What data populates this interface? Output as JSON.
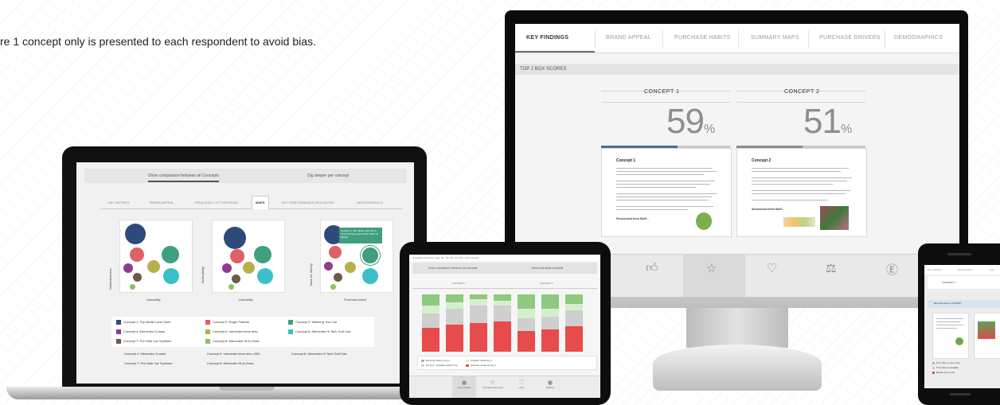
{
  "intro_text": "re 1 concept only is presented to each respondent to avoid bias.",
  "monitor": {
    "tabs": [
      {
        "label": "KEY FINDINGS",
        "active": true
      },
      {
        "label": "BRAND APPEAL",
        "active": false
      },
      {
        "label": "PURCHASE HABITS",
        "active": false
      },
      {
        "label": "SUMMARY MAPS",
        "active": false
      },
      {
        "label": "PURCHASE DRIVERS",
        "active": false
      },
      {
        "label": "DEMOGRAPHICS",
        "active": false
      }
    ],
    "section_title": "TOP 2 BOX SCORES",
    "concepts": [
      {
        "name": "CONCEPT 1",
        "score": "59",
        "unit": "%",
        "score_fraction": 0.59,
        "bar_color": "#4f6a94",
        "card_title": "Concept 1",
        "card_footer": "Second-text from Stuff..."
      },
      {
        "name": "CONCEPT 2",
        "score": "51",
        "unit": "%",
        "score_fraction": 0.51,
        "bar_color": "#8a8a92",
        "card_title": "Concept 2",
        "card_footer": "Second-text from Stuff..."
      }
    ],
    "icon_bar": [
      "thumbs-up-icon",
      "star-icon",
      "heart-icon",
      "scales-icon",
      "dollar-icon"
    ],
    "icon_bar_selected": "star-icon"
  },
  "laptop": {
    "toggle_active": "Show comparison between all Concepts",
    "toggle_other": "Dig deeper per concept",
    "tabs": [
      "KEY METRICS",
      "BRAND APPEAL",
      "FREQUENCY OF PURCHASE",
      "MAPS",
      "KEY PERFORMANCE INDICATORS",
      "DEMOGRAPHICS"
    ],
    "active_tab": "MAPS",
    "map_y_labels": [
      "Distinctiveness",
      "Believability",
      "Value for Money"
    ],
    "map_x_labels": [
      "Likeability",
      "Likeability",
      "Purchase Intent"
    ],
    "tooltip": "Concept 4: Top Model Lane Store 71% Purchase Intent 64% Value for Money",
    "legend": [
      {
        "label": "Concept 1: Top Model Lane Store",
        "color": "#2f4a7a"
      },
      {
        "label": "Concept 2: Roger Federer",
        "color": "#e06068"
      },
      {
        "label": "Concept 3: Washing Your Car",
        "color": "#3f9f7e"
      },
      {
        "label": "Concept 4: Mercedes S-class",
        "color": "#8b3d8f"
      },
      {
        "label": "Concept 5: mercedes benz tires",
        "color": "#b7b04a"
      },
      {
        "label": "Concept 6: Mercedes Hi Tech Golf Cart",
        "color": "#3bbfc9"
      },
      {
        "label": "Concept 7: Pre-Safe Car Systems",
        "color": "#6d5a45"
      },
      {
        "label": "Concept 8: Mercedes GLA-Class",
        "color": "#8cc25a"
      }
    ],
    "legend_text_rows": [
      [
        "Concept 4: Mercedes S-class",
        "Concept 5: mercedes benz tires c300",
        "Concept 6: Mercedes Hi Tech Golf Cart"
      ],
      [
        "Concept 7: Pre-Safe Car Systems",
        "Concept 8: Mercedes GLA-Class",
        ""
      ]
    ]
  },
  "tablet": {
    "header": "Navigation Selection: Age: 18 - 34 | 35 - 54 | 55+ | All Concepts",
    "toggle": [
      "Show comparison between all concepts",
      "Show individual concepts"
    ],
    "tabs": [
      "CONCEPT 1",
      "CONCEPT 2"
    ],
    "legend": [
      {
        "label": "Extremely likely to buy it",
        "color": "#8ec97f"
      },
      {
        "label": "Probably would buy it",
        "color": "#d6eed0"
      },
      {
        "label": "Not sure / probably wouldn't buy",
        "color": "#cfcfcf"
      },
      {
        "label": "Definitely would not buy it",
        "color": "#e84b4b"
      }
    ],
    "icons": [
      {
        "label": "Key Findings",
        "icon": "thumb"
      },
      {
        "label": "Purchase Summary",
        "icon": "star"
      },
      {
        "label": "Likes",
        "icon": "heart"
      },
      {
        "label": "Dislikes",
        "icon": "thumb-down"
      }
    ]
  },
  "phone": {
    "tabs": [
      "KEY FINDINGS",
      "BRAND APPEAL",
      "PUR"
    ],
    "card": "CONCEPT 1",
    "toggle": "Mercedes options v CONCEPT",
    "legend": [
      "This is likely to come clean",
      "This is likely to Likeability",
      "Bad Mix does to pick"
    ]
  }
}
